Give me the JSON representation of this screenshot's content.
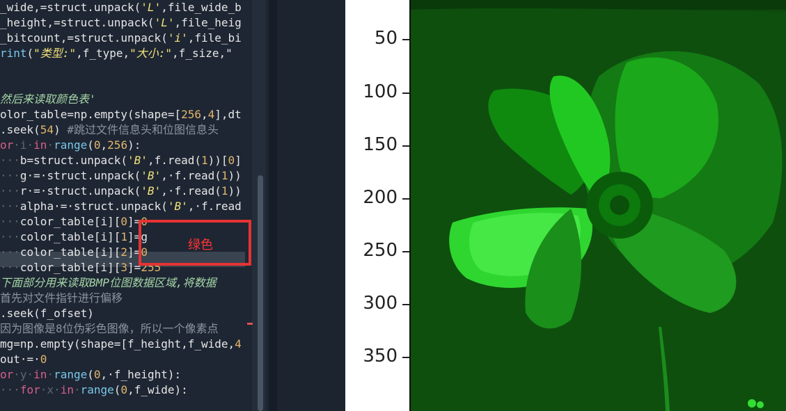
{
  "code": {
    "lines": [
      [
        {
          "t": "_wide,=struct.unpack(",
          "c": "op"
        },
        {
          "t": "'L'",
          "c": "str"
        },
        {
          "t": ",file_wide_b",
          "c": "op"
        }
      ],
      [
        {
          "t": "_height,=struct.unpack(",
          "c": "op"
        },
        {
          "t": "'L'",
          "c": "str"
        },
        {
          "t": ",file_heig",
          "c": "op"
        }
      ],
      [
        {
          "t": "_bitcount,=struct.unpack(",
          "c": "op"
        },
        {
          "t": "'i'",
          "c": "str"
        },
        {
          "t": ",file_bi",
          "c": "op"
        }
      ],
      [
        {
          "t": "rint",
          "c": "fn"
        },
        {
          "t": "(",
          "c": "op"
        },
        {
          "t": "\"类型:\"",
          "c": "str"
        },
        {
          "t": ",f_type,",
          "c": "op"
        },
        {
          "t": "\"大小:\"",
          "c": "str"
        },
        {
          "t": ",f_size,\"",
          "c": "op"
        }
      ],
      [],
      [],
      [
        {
          "t": "然后来读取颜色表'",
          "c": "cmg"
        }
      ],
      [
        {
          "t": "olor_table=np.empty(shape=[",
          "c": "op"
        },
        {
          "t": "256",
          "c": "num"
        },
        {
          "t": ",",
          "c": "op"
        },
        {
          "t": "4",
          "c": "num"
        },
        {
          "t": "],dt",
          "c": "op"
        }
      ],
      [
        {
          "t": ".seek(",
          "c": "op"
        },
        {
          "t": "54",
          "c": "num"
        },
        {
          "t": ") ",
          "c": "op"
        },
        {
          "t": "#跳过文件信息头和位图信息头",
          "c": "cm"
        }
      ],
      [
        {
          "t": "or",
          "c": "kw"
        },
        {
          "t": "·i·",
          "c": "dot"
        },
        {
          "t": "in",
          "c": "kw"
        },
        {
          "t": "·",
          "c": "dot"
        },
        {
          "t": "range",
          "c": "fn"
        },
        {
          "t": "(",
          "c": "op"
        },
        {
          "t": "0",
          "c": "num"
        },
        {
          "t": ",",
          "c": "op"
        },
        {
          "t": "256",
          "c": "num"
        },
        {
          "t": "):",
          "c": "op"
        }
      ],
      [
        {
          "t": "···",
          "c": "dot"
        },
        {
          "t": "b=struct.unpack(",
          "c": "op"
        },
        {
          "t": "'B'",
          "c": "str"
        },
        {
          "t": ",f.read(",
          "c": "op"
        },
        {
          "t": "1",
          "c": "num"
        },
        {
          "t": "))[",
          "c": "op"
        },
        {
          "t": "0",
          "c": "num"
        },
        {
          "t": "]",
          "c": "op"
        }
      ],
      [
        {
          "t": "···",
          "c": "dot"
        },
        {
          "t": "g·=·struct.unpack(",
          "c": "op"
        },
        {
          "t": "'B'",
          "c": "str"
        },
        {
          "t": ",·f.read(",
          "c": "op"
        },
        {
          "t": "1",
          "c": "num"
        },
        {
          "t": "))",
          "c": "op"
        }
      ],
      [
        {
          "t": "···",
          "c": "dot"
        },
        {
          "t": "r·=·struct.unpack(",
          "c": "op"
        },
        {
          "t": "'B'",
          "c": "str"
        },
        {
          "t": ",·f.read(",
          "c": "op"
        },
        {
          "t": "1",
          "c": "num"
        },
        {
          "t": "))",
          "c": "op"
        }
      ],
      [
        {
          "t": "···",
          "c": "dot"
        },
        {
          "t": "alpha·=·struct.unpack(",
          "c": "op"
        },
        {
          "t": "'B'",
          "c": "str"
        },
        {
          "t": ",·f.read",
          "c": "op"
        }
      ],
      [
        {
          "t": "···",
          "c": "dot"
        },
        {
          "t": "color_table[i][",
          "c": "op"
        },
        {
          "t": "0",
          "c": "num"
        },
        {
          "t": "]=",
          "c": "op"
        },
        {
          "t": "0",
          "c": "num"
        }
      ],
      [
        {
          "t": "···",
          "c": "dot"
        },
        {
          "t": "color_table[i][",
          "c": "op"
        },
        {
          "t": "1",
          "c": "num"
        },
        {
          "t": "]=g",
          "c": "op"
        }
      ],
      [
        {
          "t": "···",
          "c": "dot"
        },
        {
          "t": "color_table[i][",
          "c": "op"
        },
        {
          "t": "2",
          "c": "num"
        },
        {
          "t": "]=",
          "c": "op"
        },
        {
          "t": "0",
          "c": "num"
        }
      ],
      [
        {
          "t": "···",
          "c": "dot"
        },
        {
          "t": "color_table[i][",
          "c": "op"
        },
        {
          "t": "3",
          "c": "num"
        },
        {
          "t": "]=",
          "c": "op"
        },
        {
          "t": "255",
          "c": "num"
        }
      ],
      [
        {
          "t": "下面部分用来读取BMP位图数据区域,将数据",
          "c": "cmg"
        }
      ],
      [
        {
          "t": "首先对文件指针进行偏移",
          "c": "cm"
        }
      ],
      [
        {
          "t": ".seek(f_ofset)",
          "c": "op"
        }
      ],
      [
        {
          "t": "因为图像是8位伪彩色图像，所以一个像素点",
          "c": "cm"
        }
      ],
      [
        {
          "t": "mg=np.empty(shape=[f_height,f_wide,",
          "c": "op"
        },
        {
          "t": "4",
          "c": "num"
        }
      ],
      [
        {
          "t": "out·=·",
          "c": "op"
        },
        {
          "t": "0",
          "c": "num"
        }
      ],
      [
        {
          "t": "or",
          "c": "kw"
        },
        {
          "t": "·y·",
          "c": "dot"
        },
        {
          "t": "in",
          "c": "kw"
        },
        {
          "t": "·",
          "c": "dot"
        },
        {
          "t": "range",
          "c": "fn"
        },
        {
          "t": "(",
          "c": "op"
        },
        {
          "t": "0",
          "c": "num"
        },
        {
          "t": ",·f_height):",
          "c": "op"
        }
      ],
      [
        {
          "t": "···",
          "c": "dot"
        },
        {
          "t": "for",
          "c": "kw"
        },
        {
          "t": "·x·",
          "c": "dot"
        },
        {
          "t": "in",
          "c": "kw"
        },
        {
          "t": "·",
          "c": "dot"
        },
        {
          "t": "range",
          "c": "fn"
        },
        {
          "t": "(",
          "c": "op"
        },
        {
          "t": "0",
          "c": "num"
        },
        {
          "t": ",f_wide):",
          "c": "op"
        }
      ]
    ]
  },
  "annotation": {
    "label": "绿色"
  },
  "plot": {
    "y_ticks": [
      "50",
      "100",
      "150",
      "200",
      "250",
      "300",
      "350"
    ]
  }
}
